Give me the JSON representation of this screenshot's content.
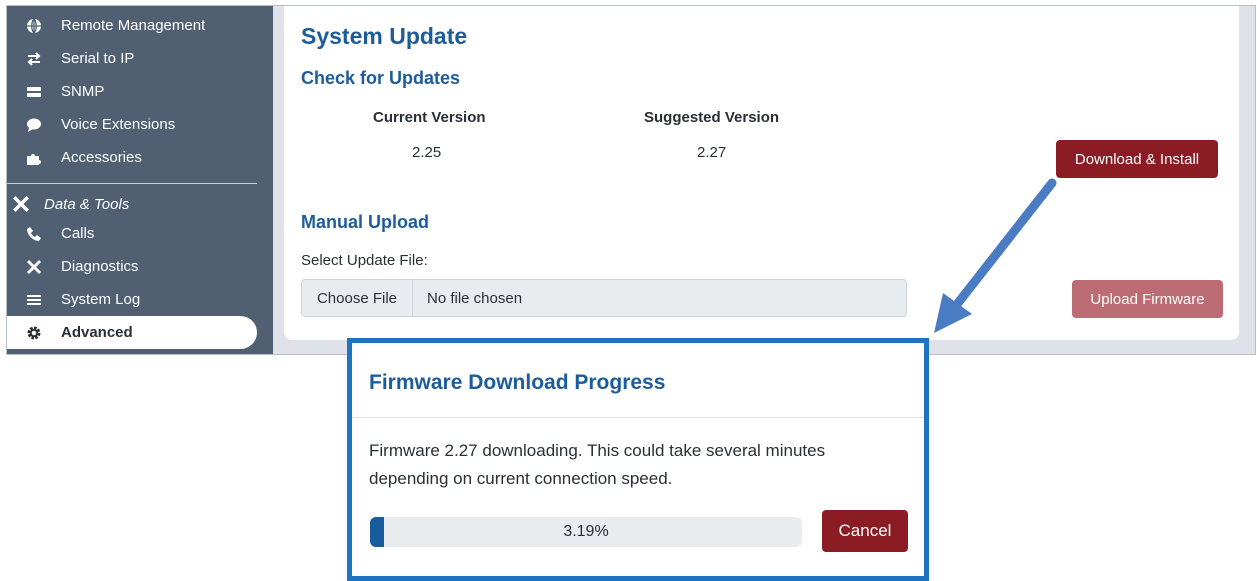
{
  "sidebar": {
    "items": [
      {
        "label": "Remote Management",
        "icon": "globe-icon"
      },
      {
        "label": "Serial to IP",
        "icon": "swap-arrows-icon"
      },
      {
        "label": "SNMP",
        "icon": "server-icon"
      },
      {
        "label": "Voice Extensions",
        "icon": "speech-bubble-icon"
      },
      {
        "label": "Accessories",
        "icon": "puzzle-icon"
      }
    ],
    "section_title": "Data & Tools",
    "tool_items": [
      {
        "label": "Calls",
        "icon": "phone-icon"
      },
      {
        "label": "Diagnostics",
        "icon": "tools-icon"
      },
      {
        "label": "System Log",
        "icon": "list-icon"
      },
      {
        "label": "Advanced",
        "icon": "gear-icon",
        "active": true
      }
    ]
  },
  "main": {
    "title": "System Update",
    "check_heading": "Check for Updates",
    "current_version_label": "Current Version",
    "current_version": "2.25",
    "suggested_version_label": "Suggested Version",
    "suggested_version": "2.27",
    "download_button": "Download & Install",
    "manual_heading": "Manual Upload",
    "file_label": "Select Update File:",
    "choose_file_button": "Choose File",
    "file_status": "No file chosen",
    "upload_button": "Upload Firmware"
  },
  "modal": {
    "title": "Firmware Download Progress",
    "message": "Firmware 2.27 downloading. This could take several minutes depending on current connection speed.",
    "progress_percent": 3.19,
    "progress_text": "3.19%",
    "cancel_button": "Cancel"
  },
  "colors": {
    "sidebar_bg": "#505f72",
    "heading_blue": "#1d5c9a",
    "primary_button": "#8b1c24",
    "disabled_button": "#bb6d73",
    "modal_border": "#1e73c3",
    "annotation_arrow": "#4a7cc4"
  }
}
